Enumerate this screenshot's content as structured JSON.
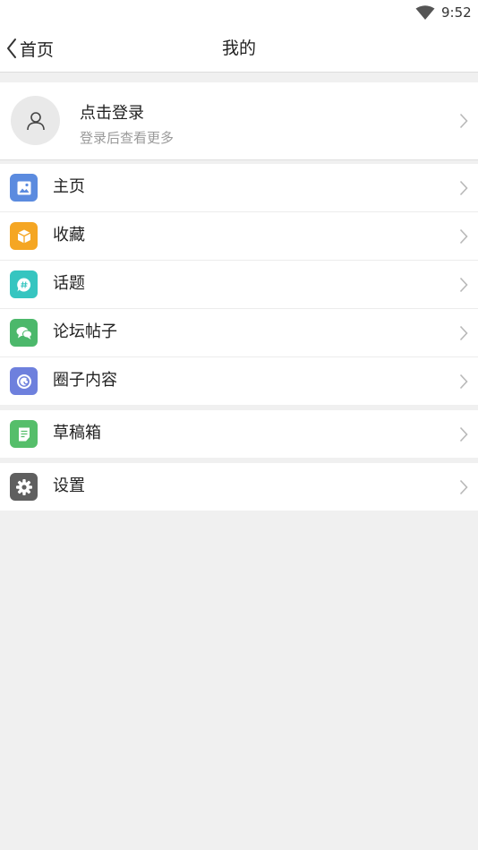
{
  "status_bar": {
    "time": "9:52",
    "wifi_icon": "wifi-icon"
  },
  "nav": {
    "back_label": "首页",
    "title": "我的"
  },
  "login": {
    "title": "点击登录",
    "subtitle": "登录后查看更多",
    "avatar_icon": "user-icon"
  },
  "groups": [
    {
      "items": [
        {
          "label": "主页",
          "icon": "image-icon",
          "color": "#5b8bdf"
        },
        {
          "label": "收藏",
          "icon": "box-icon",
          "color": "#f5a623"
        },
        {
          "label": "话题",
          "icon": "hashtag-icon",
          "color": "#36c5c0"
        },
        {
          "label": "论坛帖子",
          "icon": "chat-icon",
          "color": "#4cb86b"
        },
        {
          "label": "圈子内容",
          "icon": "circle-icon",
          "color": "#6e80dd"
        }
      ]
    },
    {
      "items": [
        {
          "label": "草稿箱",
          "icon": "note-icon",
          "color": "#55be6a"
        }
      ]
    },
    {
      "items": [
        {
          "label": "设置",
          "icon": "gear-icon",
          "color": "#5f5f5f"
        }
      ]
    }
  ],
  "colors": {
    "background": "#f0f0f0",
    "chevron": "#b8b8b8"
  }
}
